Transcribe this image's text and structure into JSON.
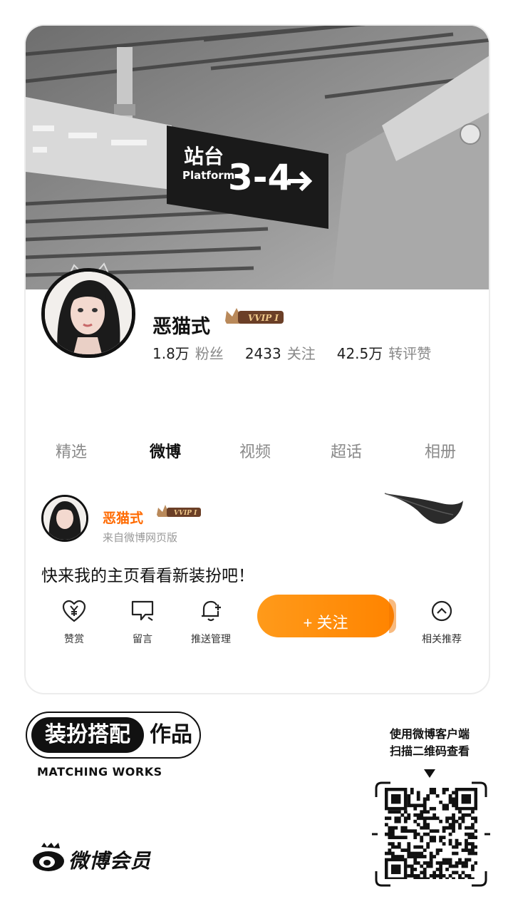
{
  "banner": {
    "sign_cn": "站台",
    "sign_en": "Platform",
    "sign_number": "3-4"
  },
  "profile": {
    "name": "恶猫式",
    "vip_badge": "VVIP I",
    "stats": [
      {
        "value": "1.8万",
        "label": "粉丝"
      },
      {
        "value": "2433",
        "label": "关注"
      },
      {
        "value": "42.5万",
        "label": "转评赞"
      }
    ]
  },
  "tabs": [
    {
      "label": "精选",
      "active": false
    },
    {
      "label": "微博",
      "active": true
    },
    {
      "label": "视频",
      "active": false
    },
    {
      "label": "超话",
      "active": false
    },
    {
      "label": "相册",
      "active": false
    }
  ],
  "post": {
    "author": "恶猫式",
    "vip_badge": "VVIP I",
    "source": "来自微博网页版",
    "text": "快来我的主页看看新装扮吧！"
  },
  "actions": [
    {
      "label": "赞赏",
      "icon": "heart-yen-icon"
    },
    {
      "label": "留言",
      "icon": "comment-icon"
    },
    {
      "label": "推送管理",
      "icon": "bell-plus-icon"
    },
    {
      "label": "相关推荐",
      "icon": "chevron-up-circle-icon"
    }
  ],
  "follow_button": "+ 关注",
  "works": {
    "dark_label": "装扮搭配",
    "light_label": "作品",
    "english": "MATCHING WORKS"
  },
  "brand": {
    "name": "微博会员"
  },
  "qr": {
    "hint_line1": "使用微博客户端",
    "hint_line2": "扫描二维码查看"
  },
  "colors": {
    "accent": "#ff8a00",
    "post_name": "#ff6a00",
    "tab_inactive": "#8a8a8a"
  }
}
